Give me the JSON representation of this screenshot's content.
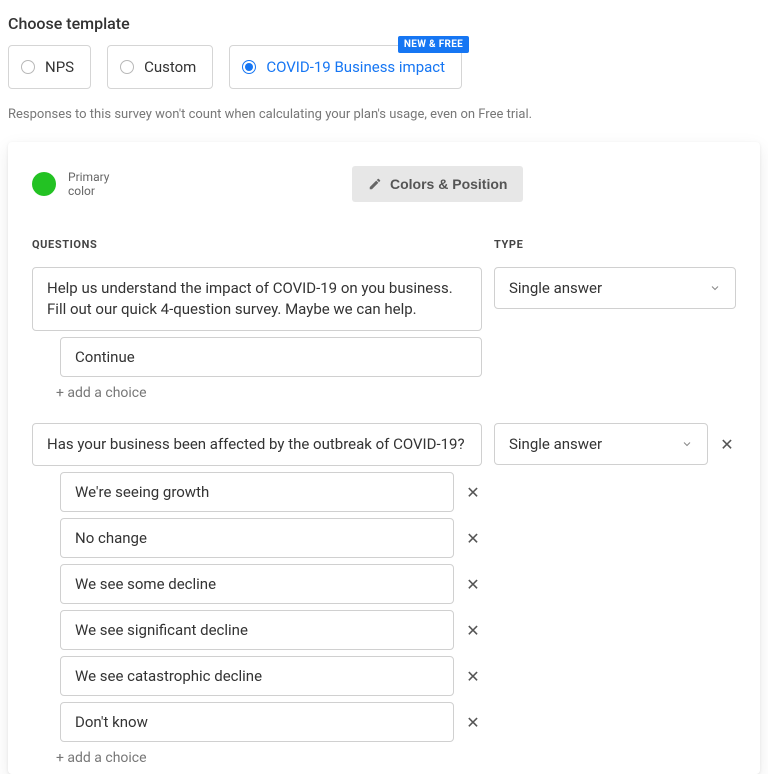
{
  "heading": "Choose template",
  "templates": [
    {
      "label": "NPS",
      "selected": false
    },
    {
      "label": "Custom",
      "selected": false
    },
    {
      "label": "COVID-19 Business impact",
      "selected": true,
      "badge": "NEW & FREE"
    }
  ],
  "note": "Responses to this survey won't count when calculating your plan's usage, even on Free trial.",
  "primaryColorLabel": "Primary color",
  "primaryColor": "#23c223",
  "colorsPositionBtn": "Colors & Position",
  "columnHeaders": {
    "questions": "QUESTIONS",
    "type": "TYPE"
  },
  "addChoiceLabel": "+ add a choice",
  "questions": [
    {
      "text": "Help us understand the impact of COVID-19 on you business. Fill out our quick 4-question survey. Maybe we can help.",
      "type": "Single answer",
      "removable": false,
      "choices": [
        {
          "text": "Continue",
          "removable": false
        }
      ]
    },
    {
      "text": "Has your business been affected by the outbreak of COVID-19?",
      "type": "Single answer",
      "removable": true,
      "choices": [
        {
          "text": "We're seeing growth",
          "removable": true
        },
        {
          "text": "No change",
          "removable": true
        },
        {
          "text": "We see some decline",
          "removable": true
        },
        {
          "text": "We see significant decline",
          "removable": true
        },
        {
          "text": "We see catastrophic decline",
          "removable": true
        },
        {
          "text": "Don't know",
          "removable": true
        }
      ]
    }
  ]
}
